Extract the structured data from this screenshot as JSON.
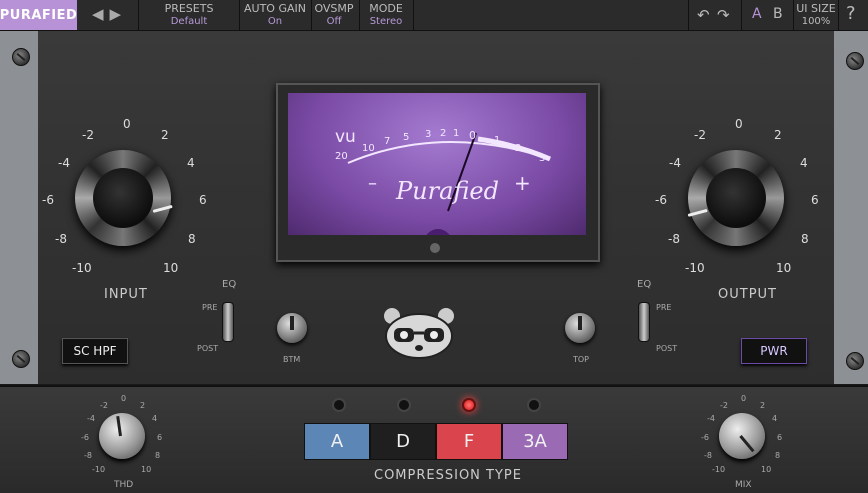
{
  "topbar": {
    "logo": "PURAFIED",
    "presets_label": "PRESETS",
    "presets_value": "Default",
    "autogain_label": "AUTO GAIN",
    "autogain_value": "On",
    "ovsmp_label": "OVSMP",
    "ovsmp_value": "Off",
    "mode_label": "MODE",
    "mode_value": "Stereo",
    "ab_a": "A",
    "ab_b": "B",
    "uisize_label": "UI SIZE",
    "uisize_value": "100%",
    "help": "?"
  },
  "input": {
    "title": "INPUT",
    "scale": [
      "-2",
      "0",
      "2",
      "-4",
      "4",
      "-6",
      "6",
      "-8",
      "8",
      "-10",
      "10"
    ]
  },
  "output": {
    "title": "OUTPUT",
    "scale": [
      "-2",
      "0",
      "2",
      "-4",
      "4",
      "-6",
      "6",
      "-8",
      "8",
      "-10",
      "10"
    ]
  },
  "vu": {
    "unit": "vu",
    "scale": [
      "20",
      "10",
      "7",
      "5",
      "3",
      "2",
      "1",
      "0",
      "1",
      "2",
      "3"
    ],
    "minus": "–",
    "plus": "+",
    "brand": "Purafied"
  },
  "eq_left": {
    "label": "EQ",
    "pre": "PRE",
    "post": "POST"
  },
  "eq_right": {
    "label": "EQ",
    "pre": "PRE",
    "post": "POST"
  },
  "btm_label": "BTM",
  "top_label": "TOP",
  "sc_hpf_label": "SC HPF",
  "pwr_label": "PWR",
  "thd": {
    "label": "THD",
    "scale": [
      "0",
      "-2",
      "2",
      "-4",
      "4",
      "-6",
      "6",
      "-8",
      "8",
      "-10",
      "10"
    ]
  },
  "mix": {
    "label": "MIX",
    "scale": [
      "0",
      "-2",
      "2",
      "-4",
      "4",
      "-6",
      "6",
      "-8",
      "8",
      "-10",
      "10"
    ]
  },
  "compression": {
    "title": "COMPRESSION TYPE",
    "types": [
      {
        "label": "A",
        "color": "#5c86b6"
      },
      {
        "label": "D",
        "color": "#1f1f1f"
      },
      {
        "label": "F",
        "color": "#d9444d"
      },
      {
        "label": "3A",
        "color": "#9a6ab4"
      }
    ],
    "active_led": 2
  },
  "colors": {
    "accent": "#b892d6",
    "led_on": "#ff3333"
  }
}
